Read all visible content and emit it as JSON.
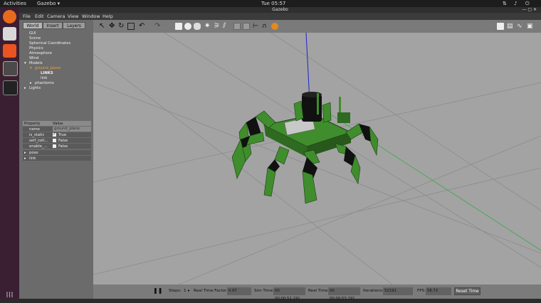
{
  "topbar": {
    "activities": "Activities",
    "app": "Gazebo ▾",
    "clock": "Tue 05:57"
  },
  "window": {
    "title": "Gazebo"
  },
  "menu": [
    "File",
    "Edit",
    "Camera",
    "View",
    "Window",
    "Help"
  ],
  "left_tabs": [
    "World",
    "Insert",
    "Layers"
  ],
  "tree": {
    "gui": "GUI",
    "scene": "Scene",
    "spherical": "Spherical Coordinates",
    "physics": "Physics",
    "atmosphere": "Atmosphere",
    "wind": "Wind",
    "models": "Models",
    "ground_plane": "ground_plane",
    "links_header": "LINKS",
    "link": "link",
    "hexa": "phantomx",
    "lights": "Lights"
  },
  "properties": {
    "header": [
      "Property",
      "Value"
    ],
    "rows": [
      {
        "name": "name",
        "value": "ground_plane"
      },
      {
        "name": "is_static",
        "value": "True"
      },
      {
        "name": "self_coll...",
        "value": "False"
      },
      {
        "name": "enable_...",
        "value": "False"
      }
    ],
    "expandables": [
      "pose",
      "link"
    ]
  },
  "status": {
    "steps_label": "Steps:",
    "steps_value": "1",
    "rtf_label": "Real Time Factor:",
    "rtf_value": "0.97",
    "sim_label": "Sim Time:",
    "sim_value": "00 00:00:52.191",
    "real_label": "Real Time:",
    "real_value": "00 00:00:53.191",
    "iter_label": "Iterations:",
    "iter_value": "52191",
    "fps_label": "FPS:",
    "fps_value": "58.72",
    "reset_label": "Reset Time"
  },
  "colors": {
    "robot_green": "#3f8d2c",
    "selection_orange": "#f0a030",
    "axis_blue": "#2020d0"
  }
}
